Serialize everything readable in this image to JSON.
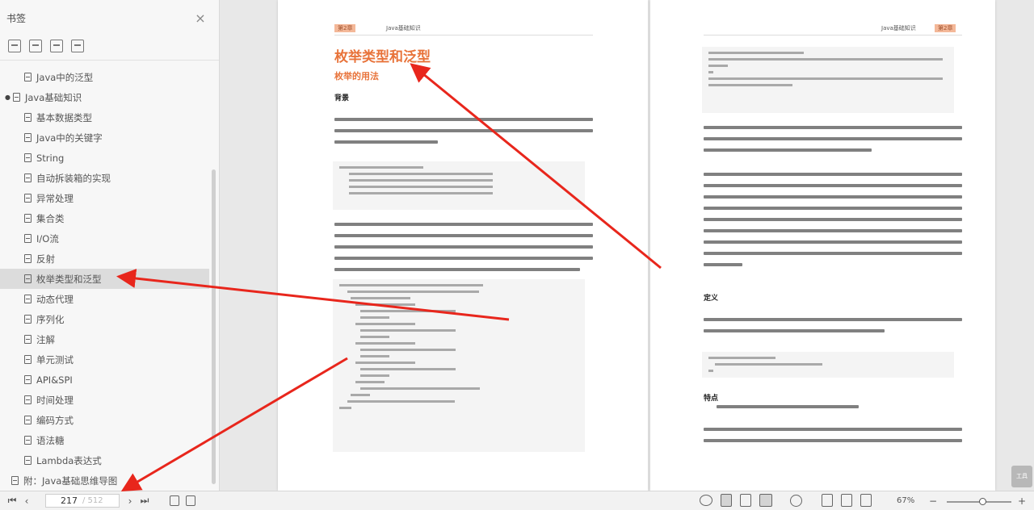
{
  "sidebar": {
    "title": "书签",
    "close_label": "×",
    "tools": [
      "bookmark-tool-icon",
      "add-bookmark-icon",
      "expand-all-icon",
      "collapse-all-icon"
    ],
    "items": [
      {
        "label": "Java中的泛型"
      },
      {
        "label": "Java基础知识"
      },
      {
        "label": "基本数据类型"
      },
      {
        "label": "Java中的关键字"
      },
      {
        "label": "String"
      },
      {
        "label": "自动拆装箱的实现"
      },
      {
        "label": "异常处理"
      },
      {
        "label": "集合类"
      },
      {
        "label": "I/O流"
      },
      {
        "label": "反射"
      },
      {
        "label": "枚举类型和泛型"
      },
      {
        "label": "动态代理"
      },
      {
        "label": "序列化"
      },
      {
        "label": "注解"
      },
      {
        "label": "单元测试"
      },
      {
        "label": "API&SPI"
      },
      {
        "label": "时间处理"
      },
      {
        "label": "编码方式"
      },
      {
        "label": "语法糖"
      },
      {
        "label": "Lambda表达式"
      },
      {
        "label": "附：Java基础思维导图"
      }
    ]
  },
  "document": {
    "left_page": {
      "header_tag": "第2章",
      "header_text": "Java基础知识",
      "title": "枚举类型和泛型",
      "subtitle": "枚举的用法",
      "section": "背景"
    },
    "right_page": {
      "header_text": "Java基础知识",
      "header_tag": "第2章",
      "section_definition": "定义",
      "section_features": "特点"
    }
  },
  "statusbar": {
    "first": "⏮",
    "prev": "‹",
    "page_number": "217",
    "page_total": "/ 512",
    "next": "›",
    "last": "⏭",
    "zoom": "67%",
    "zoom_level": 0.55,
    "zoom_minus": "−",
    "zoom_plus": "+"
  },
  "side_tab": "工具"
}
